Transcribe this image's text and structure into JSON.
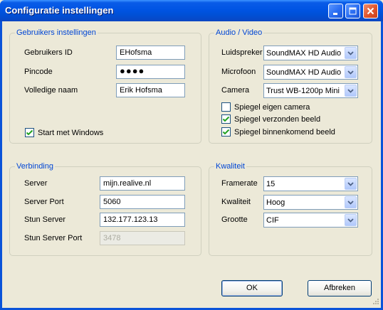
{
  "window": {
    "title": "Configuratie instellingen"
  },
  "user": {
    "title": "Gebruikers instellingen",
    "id_label": "Gebruikers ID",
    "id_value": "EHofsma",
    "pin_label": "Pincode",
    "pin_value": "●●●●",
    "name_label": "Volledige naam",
    "name_value": "Erik Hofsma",
    "start_label": "Start met Windows",
    "start_checked": true
  },
  "av": {
    "title": "Audio / Video",
    "speaker_label": "Luidspreker",
    "speaker_value": "SoundMAX HD Audio",
    "mic_label": "Microfoon",
    "mic_value": "SoundMAX HD Audio",
    "camera_label": "Camera",
    "camera_value": "Trust WB-1200p Mini",
    "mirror_own_label": "Spiegel eigen camera",
    "mirror_own_checked": false,
    "mirror_sent_label": "Spiegel verzonden beeld",
    "mirror_sent_checked": true,
    "mirror_in_label": "Spiegel binnenkomend beeld",
    "mirror_in_checked": true
  },
  "connection": {
    "title": "Verbinding",
    "server_label": "Server",
    "server_value": "mijn.realive.nl",
    "port_label": "Server Port",
    "port_value": "5060",
    "stun_label": "Stun Server",
    "stun_value": "132.177.123.13",
    "stun_port_label": "Stun Server Port",
    "stun_port_value": "3478"
  },
  "quality": {
    "title": "Kwaliteit",
    "framerate_label": "Framerate",
    "framerate_value": "15",
    "quality_label": "Kwaliteit",
    "quality_value": "Hoog",
    "size_label": "Grootte",
    "size_value": "CIF"
  },
  "buttons": {
    "ok": "OK",
    "cancel": "Afbreken"
  },
  "colors": {
    "titlebar": "#0054e3",
    "group_title": "#0046d5",
    "dialog_bg": "#ece9d8"
  }
}
